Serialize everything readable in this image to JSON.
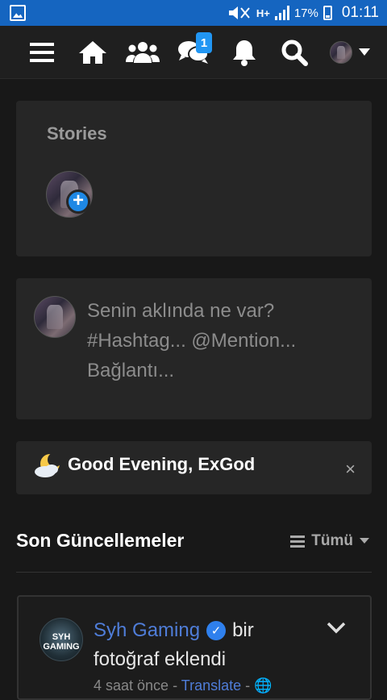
{
  "status_bar": {
    "battery": "17%",
    "time": "01:11",
    "network": "H+"
  },
  "nav": {
    "messages_badge": "1"
  },
  "stories": {
    "title": "Stories"
  },
  "composer": {
    "line1": "Senin aklında ne var?",
    "line2": "#Hashtag... @Mention...",
    "line3": "Bağlantı..."
  },
  "greeting": {
    "text": "Good Evening, ExGod",
    "close": "×"
  },
  "section": {
    "title": "Son Güncellemeler",
    "filter_label": "Tümü"
  },
  "post": {
    "author": "Syh Gaming",
    "action_a": "bir",
    "action_b": "fotoğraf eklendi",
    "time": "4 saat önce",
    "translate": "Translate",
    "separator": "-",
    "avatar_text": "SYH GAMING"
  },
  "colors": {
    "accent": "#2196f3",
    "link": "#4f7dd8",
    "background": "#181818",
    "card": "#262626"
  }
}
